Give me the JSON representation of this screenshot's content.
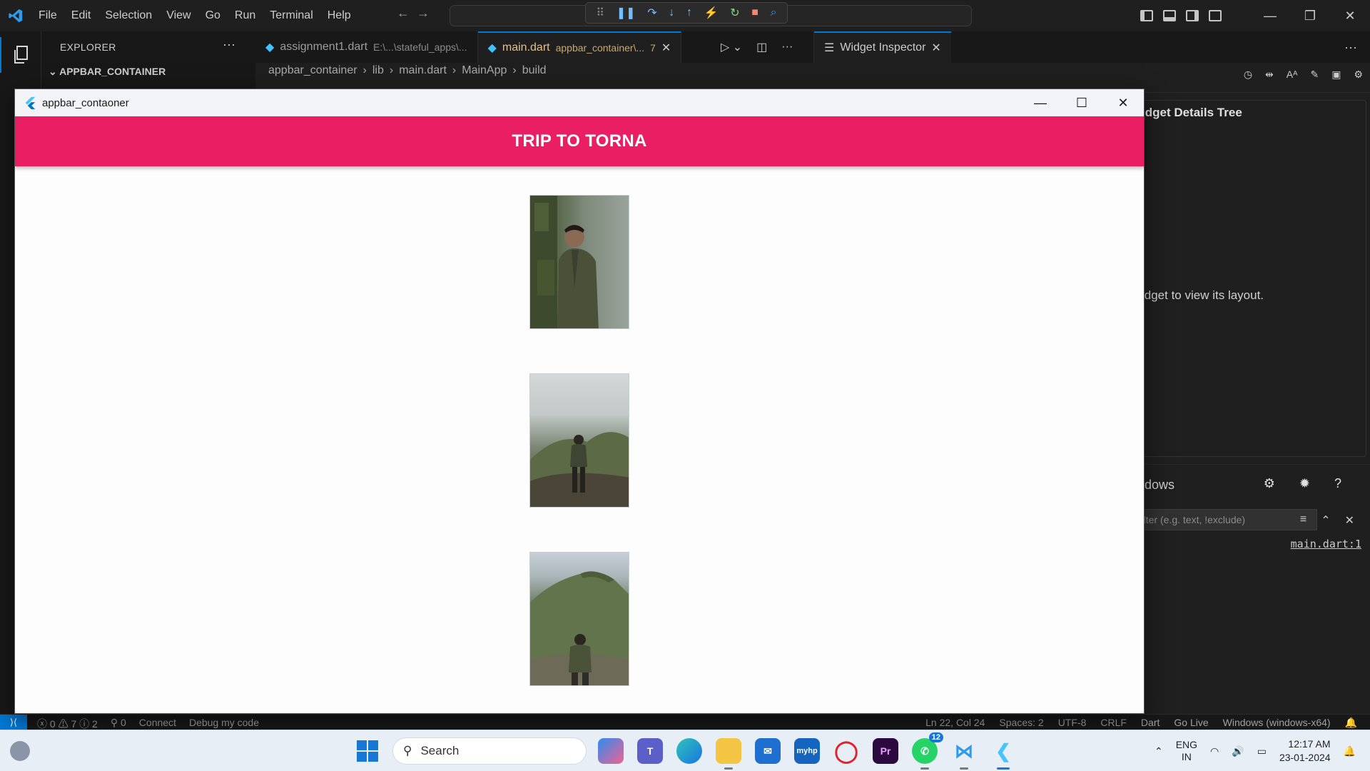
{
  "vscode": {
    "menu": [
      "File",
      "Edit",
      "Selection",
      "View",
      "Go",
      "Run",
      "Terminal",
      "Help"
    ],
    "sidebar": {
      "title": "EXPLORER",
      "folder": "APPBAR_CONTAINER"
    },
    "tabs": [
      {
        "name": "assignment1.dart",
        "desc": "E:\\...\\stateful_apps\\..."
      },
      {
        "name": "main.dart",
        "desc": "appbar_container\\...",
        "problems": "7"
      }
    ],
    "breadcrumb": [
      "appbar_container",
      "lib",
      "main.dart",
      "MainApp",
      "build"
    ],
    "inspector": {
      "tab_label": "Widget Inspector",
      "details_title": "idget Details Tree",
      "hint": "idget to view its layout.",
      "windows_label": "indows",
      "filter_placeholder": "Filter (e.g. text, !exclude)",
      "source_link": "main.dart:1"
    },
    "statusbar": {
      "errors": "0",
      "warnings": "7",
      "infos": "2",
      "ports": "0",
      "connect": "Connect",
      "debug": "Debug my code",
      "position": "Ln 22, Col 24",
      "spaces": "Spaces: 2",
      "encoding": "UTF-8",
      "eol": "CRLF",
      "language": "Dart",
      "golive": "Go Live",
      "device": "Windows (windows-x64)"
    }
  },
  "app_window": {
    "title": "appbar_contaoner",
    "appbar_title": "TRIP TO TORNA",
    "photos": [
      "man-leaning-on-mossy-rock",
      "man-facing-foggy-valley",
      "man-facing-green-mountain"
    ]
  },
  "taskbar": {
    "search_label": "Search",
    "whatsapp_badge": "12",
    "lang_top": "ENG",
    "lang_bottom": "IN",
    "time": "12:17 AM",
    "date": "23-01-2024"
  },
  "colors": {
    "appbar": "#e91e63",
    "vscode_accent": "#0078d4"
  }
}
